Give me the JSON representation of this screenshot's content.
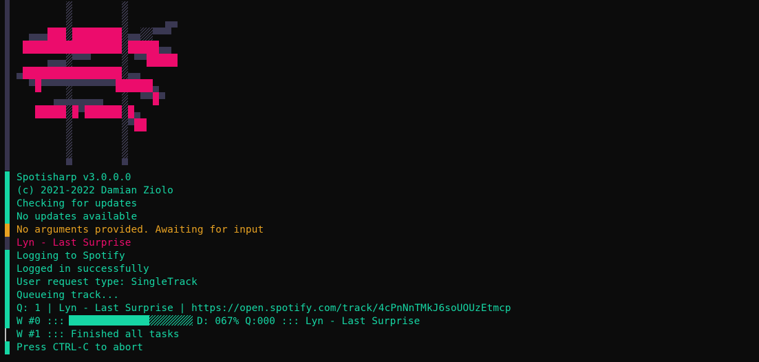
{
  "terminal": {
    "colors": {
      "background": "#0c0c0c",
      "text": "#16d6a4",
      "warning": "#e8a222",
      "accent": "#ec0c6c",
      "art_shadow": "#3a3852"
    },
    "lines": {
      "version": "Spotisharp v3.0.0.0",
      "copyright": "(c) 2021-2022 Damian Ziolo",
      "checking": "Checking for updates",
      "no_updates": "No updates available",
      "no_args": "No arguments provided. Awaiting for input",
      "track_input": "Lyn - Last Surprise",
      "logging": "Logging to Spotify",
      "logged_in": "Logged in successfully",
      "request_type": "User request type: SingleTrack",
      "queueing": "Queueing track...",
      "queue_item": "Q: 1 | Lyn - Last Surprise | https://open.spotify.com/track/4cPnNnTMkJ6soUOUzEtmcp",
      "worker0_prefix": "W #0 :::",
      "worker0_status": "D: 067% Q:000 ::: Lyn - Last Surprise",
      "worker1": "W #1 ::: Finished all tasks",
      "abort_hint": "Press CTRL-C to abort"
    },
    "worker0_progress": 0.67
  }
}
